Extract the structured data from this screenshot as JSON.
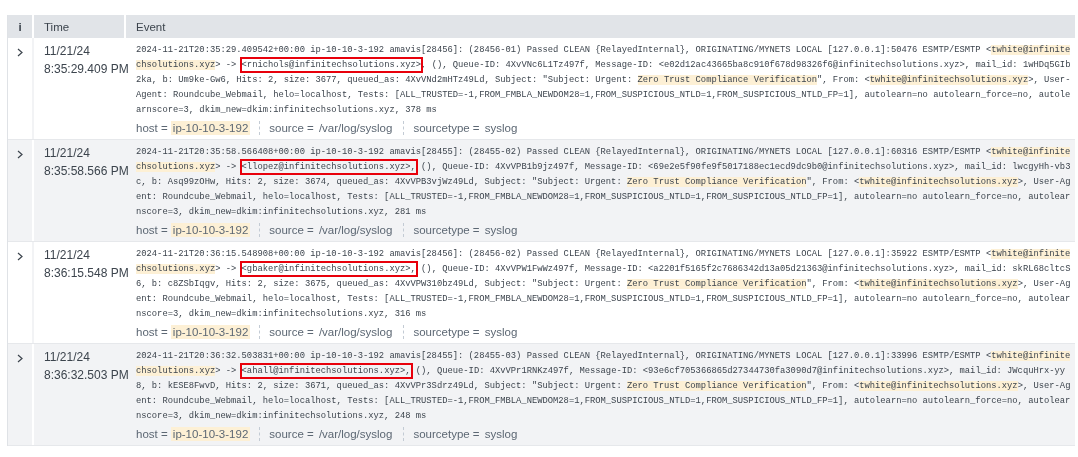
{
  "table": {
    "columns": [
      {
        "label": "i"
      },
      {
        "label": "Time"
      },
      {
        "label": "Event"
      }
    ],
    "rows": [
      {
        "date": "11/21/24",
        "time": "8:35:29.409 PM",
        "lines": [
          [
            "2024-11-21T20:35:29.409542+00:00 ip-10-10-3-192 amavis[28456]: (28456-01) Passed CLEAN {RelayedInternal}, ORIGINATING/MYNETS LOCAL [127.0.0.1]:50476 ESMTP/ESMTP <",
            {
              "text": "twhite@infinite",
              "kind": "highlight"
            }
          ],
          [
            {
              "text": "chsolutions.xyz",
              "kind": "highlight"
            },
            "> -> ",
            {
              "text": "<rnichols@infinitechsolutions.xyz>",
              "kind": "outline"
            },
            ", (), Queue-ID: 4XvVNc6L1Tz497f, Message-ID: <e02d12ac43665ba8c910f678d98326f6@infinitechsolutions.xyz>, mail_id: 1wHDq5GIb"
          ],
          [
            "2ka, b: Um9ke-Gw6, Hits: 2, size: 3677, queued_as: 4XvVNd2mHTz49Ld, Subject: \"Subject: Urgent: ",
            {
              "text": "Zero Trust Compliance Verification",
              "kind": "highlight"
            },
            "\", From: <",
            {
              "text": "twhite@infinitechsolutions.xyz",
              "kind": "highlight"
            },
            ">, User-"
          ],
          [
            "Agent: Roundcube_Webmail, helo=localhost, Tests: [ALL_TRUSTED=-1,FROM_FMBLA_NEWDOM28=1,FROM_SUSPICIOUS_NTLD=1,FROM_SUSPICIOUS_NTLD_FP=1], autolearn=no autolearn_force=no, autole"
          ],
          [
            "arnscore=3, dkim_new=dkim:infinitechsolutions.xyz, 378 ms"
          ]
        ],
        "fields": [
          {
            "label": "host =",
            "value": "ip-10-10-3-192",
            "highlighted": true
          },
          {
            "label": "source =",
            "value": "/var/log/syslog",
            "highlighted": false
          },
          {
            "label": "sourcetype =",
            "value": "syslog",
            "highlighted": false
          }
        ]
      },
      {
        "date": "11/21/24",
        "time": "8:35:58.566 PM",
        "lines": [
          [
            "2024-11-21T20:35:58.566408+00:00 ip-10-10-3-192 amavis[28455]: (28455-02) Passed CLEAN {RelayedInternal}, ORIGINATING/MYNETS LOCAL [127.0.0.1]:60316 ESMTP/ESMTP <",
            {
              "text": "twhite@infinite",
              "kind": "highlight"
            }
          ],
          [
            {
              "text": "chsolutions.xyz",
              "kind": "highlight"
            },
            "> -> ",
            {
              "text": "<llopez@infinitechsolutions.xyz>,",
              "kind": "outline"
            },
            " (), Queue-ID: 4XvVPB1b9jz497f, Message-ID: <69e2e5f90fe9f5017188ec1ecd9dc9b0@infinitechsolutions.xyz>, mail_id: lwcgyHh-vb3"
          ],
          [
            "c, b: Asq99zOHw, Hits: 2, size: 3674, queued_as: 4XvVPB3vjWz49Ld, Subject: \"Subject: Urgent: ",
            {
              "text": "Zero Trust Compliance Verification",
              "kind": "highlight"
            },
            "\", From: <",
            {
              "text": "twhite@infinitechsolutions.xyz",
              "kind": "highlight"
            },
            ">, User-Ag"
          ],
          [
            "ent: Roundcube_Webmail, helo=localhost, Tests: [ALL_TRUSTED=-1,FROM_FMBLA_NEWDOM28=1,FROM_SUSPICIOUS_NTLD=1,FROM_SUSPICIOUS_NTLD_FP=1], autolearn=no autolearn_force=no, autolear"
          ],
          [
            "nscore=3, dkim_new=dkim:infinitechsolutions.xyz, 281 ms"
          ]
        ],
        "fields": [
          {
            "label": "host =",
            "value": "ip-10-10-3-192",
            "highlighted": true
          },
          {
            "label": "source =",
            "value": "/var/log/syslog",
            "highlighted": false
          },
          {
            "label": "sourcetype =",
            "value": "syslog",
            "highlighted": false
          }
        ]
      },
      {
        "date": "11/21/24",
        "time": "8:36:15.548 PM",
        "lines": [
          [
            "2024-11-21T20:36:15.548908+00:00 ip-10-10-3-192 amavis[28456]: (28456-02) Passed CLEAN {RelayedInternal}, ORIGINATING/MYNETS LOCAL [127.0.0.1]:35922 ESMTP/ESMTP <",
            {
              "text": "twhite@infinite",
              "kind": "highlight"
            }
          ],
          [
            {
              "text": "chsolutions.xyz",
              "kind": "highlight"
            },
            "> -> ",
            {
              "text": "<gbaker@infinitechsolutions.xyz>,",
              "kind": "outline"
            },
            " (), Queue-ID: 4XvVPW1FwWz497f, Message-ID: <a2201f5165f2c7686342d13a05d21363@infinitechsolutions.xyz>, mail_id: skRL68cltcS"
          ],
          [
            "6, b: c8ZSbIqgv, Hits: 2, size: 3675, queued_as: 4XvVPW310bz49Ld, Subject: \"Subject: Urgent: ",
            {
              "text": "Zero Trust Compliance Verification",
              "kind": "highlight"
            },
            "\", From: <",
            {
              "text": "twhite@infinitechsolutions.xyz",
              "kind": "highlight"
            },
            ">, User-Ag"
          ],
          [
            "ent: Roundcube_Webmail, helo=localhost, Tests: [ALL_TRUSTED=-1,FROM_FMBLA_NEWDOM28=1,FROM_SUSPICIOUS_NTLD=1,FROM_SUSPICIOUS_NTLD_FP=1], autolearn=no autolearn_force=no, autolear"
          ],
          [
            "nscore=3, dkim_new=dkim:infinitechsolutions.xyz, 316 ms"
          ]
        ],
        "fields": [
          {
            "label": "host =",
            "value": "ip-10-10-3-192",
            "highlighted": true
          },
          {
            "label": "source =",
            "value": "/var/log/syslog",
            "highlighted": false
          },
          {
            "label": "sourcetype =",
            "value": "syslog",
            "highlighted": false
          }
        ]
      },
      {
        "date": "11/21/24",
        "time": "8:36:32.503 PM",
        "lines": [
          [
            "2024-11-21T20:36:32.503831+00:00 ip-10-10-3-192 amavis[28455]: (28455-03) Passed CLEAN {RelayedInternal}, ORIGINATING/MYNETS LOCAL [127.0.0.1]:33996 ESMTP/ESMTP <",
            {
              "text": "twhite@infinite",
              "kind": "highlight"
            }
          ],
          [
            {
              "text": "chsolutions.xyz",
              "kind": "highlight"
            },
            "> -> ",
            {
              "text": "<ahall@infinitechsolutions.xyz>,",
              "kind": "outline"
            },
            " (), Queue-ID: 4XvVPr1RNKz497f, Message-ID: <93e6cf705366865d27344730fa3090d7@infinitechsolutions.xyz>, mail_id: JWcquHrx-yy"
          ],
          [
            "8, b: kESE8FwvD, Hits: 2, size: 3671, queued_as: 4XvVPr3Sdrz49Ld, Subject: \"Subject: Urgent: ",
            {
              "text": "Zero Trust Compliance Verification",
              "kind": "highlight"
            },
            "\", From: <",
            {
              "text": "twhite@infinitechsolutions.xyz",
              "kind": "highlight"
            },
            ">, User-Ag"
          ],
          [
            "ent: Roundcube_Webmail, helo=localhost, Tests: [ALL_TRUSTED=-1,FROM_FMBLA_NEWDOM28=1,FROM_SUSPICIOUS_NTLD=1,FROM_SUSPICIOUS_NTLD_FP=1], autolearn=no autolearn_force=no, autolear"
          ],
          [
            "nscore=3, dkim_new=dkim:infinitechsolutions.xyz, 248 ms"
          ]
        ],
        "fields": [
          {
            "label": "host =",
            "value": "ip-10-10-3-192",
            "highlighted": true
          },
          {
            "label": "source =",
            "value": "/var/log/syslog",
            "highlighted": false
          },
          {
            "label": "sourcetype =",
            "value": "syslog",
            "highlighted": false
          }
        ]
      }
    ]
  }
}
